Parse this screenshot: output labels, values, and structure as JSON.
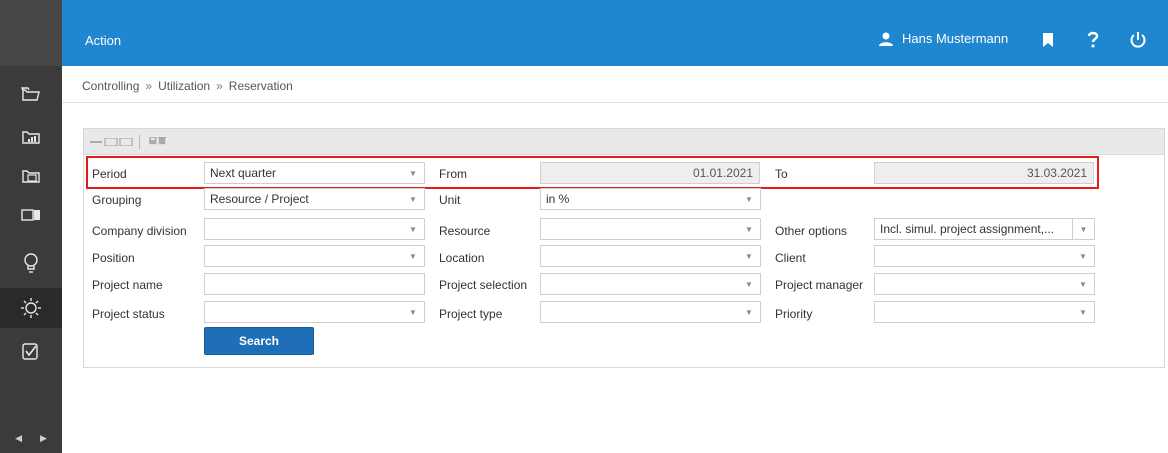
{
  "header": {
    "title": "Action",
    "user_name": "Hans Mustermann",
    "colors": {
      "header_bg": "#1f86d0",
      "sidebar_bg": "#3b3b3b",
      "highlight": "#e21b1b",
      "button": "#1f6fb8"
    }
  },
  "sidebar": {
    "items": [
      {
        "icon": "folder-open-icon"
      },
      {
        "icon": "chart-folder-icon"
      },
      {
        "icon": "calendar-folder-icon"
      },
      {
        "icon": "panel-toggle-icon"
      },
      {
        "icon": "lightbulb-icon"
      },
      {
        "icon": "sun-icon"
      },
      {
        "icon": "checkbox-icon"
      }
    ],
    "arrow_left": "◀",
    "arrow_right": "▶"
  },
  "breadcrumb": {
    "items": [
      "Controlling",
      "Utilization",
      "Reservation"
    ],
    "separator": "»"
  },
  "form": {
    "period": {
      "label": "Period",
      "value": "Next quarter"
    },
    "from": {
      "label": "From",
      "value": "01.01.2021"
    },
    "to": {
      "label": "To",
      "value": "31.03.2021"
    },
    "grouping": {
      "label": "Grouping",
      "value": "Resource / Project"
    },
    "unit": {
      "label": "Unit",
      "value": "in %"
    },
    "company_division": {
      "label": "Company division",
      "value": ""
    },
    "resource": {
      "label": "Resource",
      "value": ""
    },
    "other_options": {
      "label": "Other options",
      "value": "Incl. simul. project assignment,..."
    },
    "position": {
      "label": "Position",
      "value": ""
    },
    "location": {
      "label": "Location",
      "value": ""
    },
    "client": {
      "label": "Client",
      "value": ""
    },
    "project_name": {
      "label": "Project name",
      "value": ""
    },
    "project_selection": {
      "label": "Project selection",
      "value": ""
    },
    "project_manager": {
      "label": "Project manager",
      "value": ""
    },
    "project_status": {
      "label": "Project status",
      "value": ""
    },
    "project_type": {
      "label": "Project type",
      "value": ""
    },
    "priority": {
      "label": "Priority",
      "value": ""
    },
    "search_label": "Search",
    "dropdown_glyph": "▼"
  }
}
